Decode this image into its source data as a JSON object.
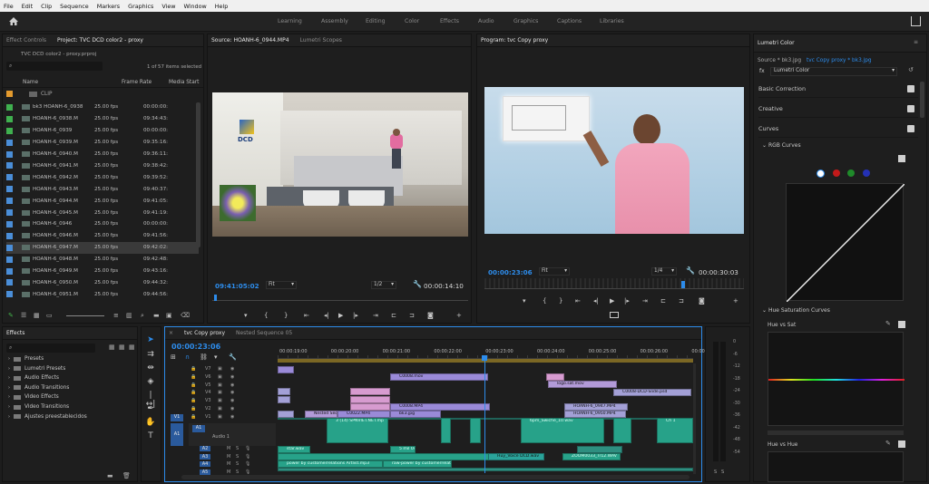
{
  "menu": [
    "File",
    "Edit",
    "Clip",
    "Sequence",
    "Markers",
    "Graphics",
    "View",
    "Window",
    "Help"
  ],
  "workspaces": [
    "Learning",
    "Assembly",
    "Editing",
    "Color",
    "Effects",
    "Audio",
    "Graphics",
    "Captions",
    "Libraries"
  ],
  "project": {
    "tabs": [
      "Effect Controls",
      "Project: TVC DCD color2 - proxy"
    ],
    "file": "TVC DCD color2 - proxy.prproj",
    "count": "1 of 57 items selected",
    "cols": [
      "Name",
      "Frame Rate",
      "Media Start"
    ],
    "bin": "CLIP",
    "rows": [
      {
        "n": "bk3 HOANH-6_0938",
        "f": "25.00 fps",
        "m": "00:00:00:",
        "c": "#3fb04f"
      },
      {
        "n": "HOANH-6_0938.M",
        "f": "25.00 fps",
        "m": "09:34:43:",
        "c": "#3fb04f"
      },
      {
        "n": "HOANH-6_0939",
        "f": "25.00 fps",
        "m": "00:00:00:",
        "c": "#3fb04f"
      },
      {
        "n": "HOANH-6_0939.M",
        "f": "25.00 fps",
        "m": "09:35:16:",
        "c": "#4a8ed8"
      },
      {
        "n": "HOANH-6_0940.M",
        "f": "25.00 fps",
        "m": "09:36:11:",
        "c": "#4a8ed8"
      },
      {
        "n": "HOANH-6_0941.M",
        "f": "25.00 fps",
        "m": "09:38:42:",
        "c": "#4a8ed8"
      },
      {
        "n": "HOANH-6_0942.M",
        "f": "25.00 fps",
        "m": "09:39:52:",
        "c": "#4a8ed8"
      },
      {
        "n": "HOANH-6_0943.M",
        "f": "25.00 fps",
        "m": "09:40:37:",
        "c": "#4a8ed8"
      },
      {
        "n": "HOANH-6_0944.M",
        "f": "25.00 fps",
        "m": "09:41:05:",
        "c": "#4a8ed8"
      },
      {
        "n": "HOANH-6_0945.M",
        "f": "25.00 fps",
        "m": "09:41:19:",
        "c": "#4a8ed8"
      },
      {
        "n": "HOANH-6_0946",
        "f": "25.00 fps",
        "m": "00:00:00:",
        "c": "#4a8ed8"
      },
      {
        "n": "HOANH-6_0946.M",
        "f": "25.00 fps",
        "m": "09:41:56:",
        "c": "#4a8ed8"
      },
      {
        "n": "HOANH-6_0947.M",
        "f": "25.00 fps",
        "m": "09:42:02:",
        "c": "#4a8ed8"
      },
      {
        "n": "HOANH-6_0948.M",
        "f": "25.00 fps",
        "m": "09:42:48:",
        "c": "#4a8ed8"
      },
      {
        "n": "HOANH-6_0949.M",
        "f": "25.00 fps",
        "m": "09:43:16:",
        "c": "#4a8ed8"
      },
      {
        "n": "HOANH-6_0950.M",
        "f": "25.00 fps",
        "m": "09:44:32:",
        "c": "#4a8ed8"
      },
      {
        "n": "HOANH-6_0951.M",
        "f": "25.00 fps",
        "m": "09:44:56:",
        "c": "#4a8ed8"
      }
    ]
  },
  "source": {
    "tabs": [
      "Source: HOANH-6_0944.MP4",
      "Lumetri Scopes"
    ],
    "tc": "09:41:05:02",
    "fit": "Fit",
    "res": "1/2",
    "dur": "00:00:14:10",
    "logo": "DCD"
  },
  "program": {
    "tab": "Program: tvc Copy proxy",
    "tc": "00:00:23:06",
    "fit": "Fit",
    "res": "1/4",
    "dur": "00:00:30:03"
  },
  "lumetri": {
    "tab": "Lumetri Color",
    "source": "Source * bk3.jpg",
    "target": "tvc Copy proxy * bk3.jpg",
    "effect": "Lumetri Color",
    "sections": [
      "Basic Correction",
      "Creative",
      "Curves"
    ],
    "rgb": "RGB Curves",
    "hsc": "Hue Saturation Curves",
    "hvs": "Hue vs Sat",
    "hvh": "Hue vs Hue"
  },
  "effects": {
    "tab": "Effects",
    "items": [
      "Presets",
      "Lumetri Presets",
      "Audio Effects",
      "Audio Transitions",
      "Video Effects",
      "Video Transitions",
      "Ajustes preestablecidos"
    ]
  },
  "timeline": {
    "tabs": [
      "tvc Copy proxy",
      "Nested Sequence 05"
    ],
    "tc": "00:00:23:06",
    "ruler": [
      "00:00:19:00",
      "00:00:20:00",
      "00:00:21:00",
      "00:00:22:00",
      "00:00:23:00",
      "00:00:24:00",
      "00:00:25:00",
      "00:00:26:00",
      "00:00:27:00"
    ],
    "vtracks": [
      "V7",
      "V6",
      "V5",
      "V4",
      "V3",
      "V2",
      "V1"
    ],
    "atracks": [
      "A1",
      "A2",
      "A3",
      "A4",
      "A5"
    ],
    "audio1": "Audio 1",
    "src_v": "V1",
    "src_a": "A1",
    "clips": {
      "c1": "C0008.mov",
      "c2": "C0008.MP4",
      "c3": "C0022.MP4",
      "c4": "Nested Seque",
      "c5": "bk3.jpg",
      "c6": "HOANH-6_0947.MP4",
      "c7": "HOANH-6_0950.MP4",
      "c8": "C0008-DCD-Slide.psd",
      "c9": "logo.sat.mov",
      "c10": "3 (14) SPNVIET.NET.mp",
      "c11": "6pm_Swiche_10.wav",
      "c12": "star.wav",
      "c13": "5 mil 04.w",
      "c14": "Huy_Voice DCD.wav",
      "c15": "ZOOM0033_Tr12.WAV",
      "c16": "raw-power by customerrelations Artlist.mp3",
      "c17": "power by customerrelations Artlist.mp3",
      "c18": "Ch 1"
    }
  },
  "meter": [
    "0",
    "-6",
    "-12",
    "-18",
    "-24",
    "-30",
    "-36",
    "-42",
    "-48",
    "-54"
  ],
  "meter_ss": [
    "S",
    "S"
  ],
  "colors": {
    "accent": "#2d8ceb",
    "clip_video": "#9a8ad8",
    "clip_audio": "#27a289"
  }
}
